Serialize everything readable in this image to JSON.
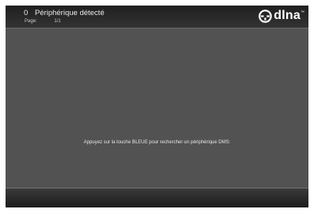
{
  "header": {
    "device_count": "0",
    "title": "Périphérique détecté",
    "page_label": "Page:",
    "page_value": "1/1"
  },
  "logo": {
    "name": "dlna",
    "icon": "dlna-logo-icon",
    "trademark": "™"
  },
  "main": {
    "message": "Appuyez sur la touche BLEUE pour rechercher un périphérique DMS:"
  },
  "colors": {
    "background": "#535353",
    "header": "#2b2b2b",
    "footer": "#2a2a2a",
    "text": "#eaeaea"
  }
}
